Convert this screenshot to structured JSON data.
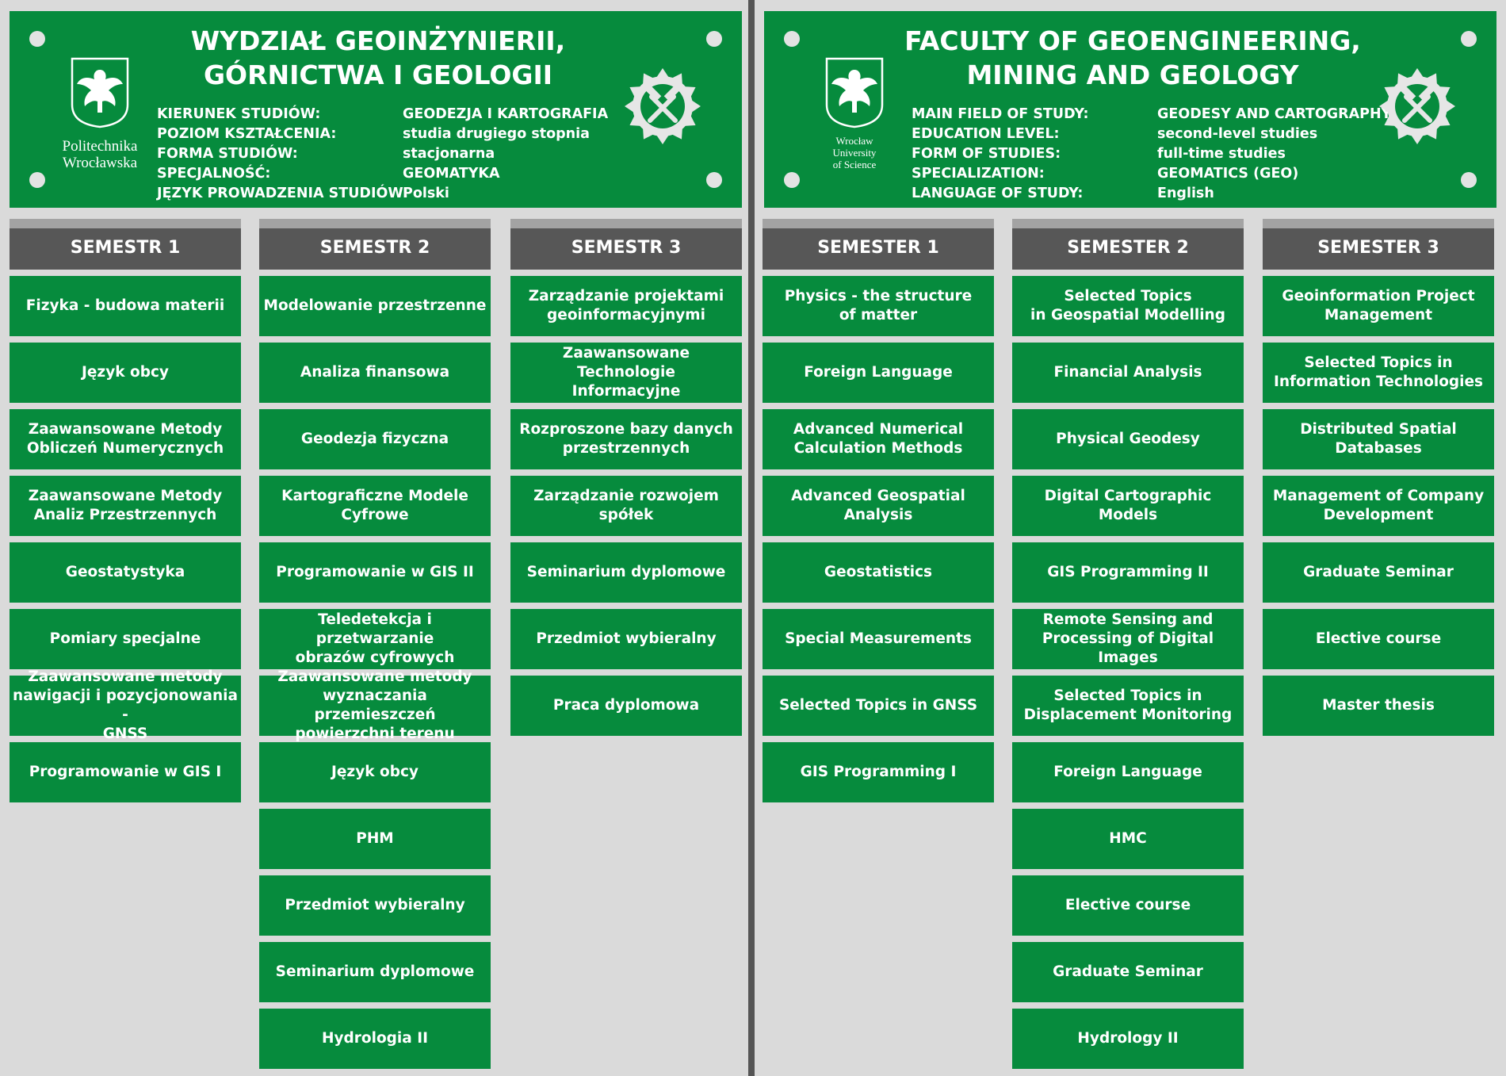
{
  "colors": {
    "green": "#068b3d",
    "semester_header": "#575757",
    "background": "#dadada"
  },
  "icons": {
    "logo": "eagle-crest-icon",
    "emblem": "gear-hammer-icon"
  },
  "pl": {
    "title": "WYDZIAŁ GEOINŻYNIERII,\nGÓRNICTWA I GEOLOGII",
    "logo_text": "Politechnika\nWrocławska",
    "info": [
      {
        "label": "KIERUNEK STUDIÓW:",
        "value": "GEODEZJA I KARTOGRAFIA"
      },
      {
        "label": "POZIOM KSZTAŁCENIA:",
        "value": "studia drugiego stopnia"
      },
      {
        "label": "FORMA STUDIÓW:",
        "value": "stacjonarna"
      },
      {
        "label": "SPECJALNOŚĆ:",
        "value": "GEOMATYKA"
      },
      {
        "label": "JĘZYK PROWADZENIA STUDIÓW:",
        "value": "Polski"
      }
    ],
    "semesters": [
      {
        "name": "SEMESTR 1",
        "courses": [
          "Fizyka - budowa materii",
          "Język obcy",
          "Zaawansowane Metody\nObliczeń Numerycznych",
          "Zaawansowane Metody\nAnaliz Przestrzennych",
          "Geostatystyka",
          "Pomiary specjalne",
          "Zaawansowane metody\nnawigacji i pozycjonowania -\nGNSS",
          "Programowanie w GIS I"
        ]
      },
      {
        "name": "SEMESTR 2",
        "courses": [
          "Modelowanie przestrzenne",
          "Analiza finansowa",
          "Geodezja fizyczna",
          "Kartograficzne Modele\nCyfrowe",
          "Programowanie w GIS II",
          "Teledetekcja i przetwarzanie\nobrazów cyfrowych",
          "Zaawansowane metody\nwyznaczania przemieszczeń\npowierzchni terenu",
          "Język obcy",
          "PHM",
          "Przedmiot wybieralny",
          "Seminarium dyplomowe",
          "Hydrologia II"
        ]
      },
      {
        "name": "SEMESTR 3",
        "courses": [
          "Zarządzanie projektami\ngeoinformacyjnymi",
          "Zaawansowane Technologie\nInformacyjne",
          "Rozproszone bazy danych\nprzestrzennych",
          "Zarządzanie rozwojem\nspółek",
          "Seminarium dyplomowe",
          "Przedmiot wybieralny",
          "Praca dyplomowa"
        ]
      }
    ]
  },
  "en": {
    "title": "FACULTY OF GEOENGINEERING,\nMINING AND GEOLOGY",
    "logo_text": "Wrocław\nUniversity\nof Science",
    "info": [
      {
        "label": "MAIN FIELD OF STUDY:",
        "value": "GEODESY AND CARTOGRAPHY"
      },
      {
        "label": "EDUCATION LEVEL:",
        "value": "second-level studies"
      },
      {
        "label": "FORM OF STUDIES:",
        "value": "full-time studies"
      },
      {
        "label": "SPECIALIZATION:",
        "value": "GEOMATICS (GEO)"
      },
      {
        "label": "LANGUAGE OF STUDY:",
        "value": "English"
      }
    ],
    "semesters": [
      {
        "name": "SEMESTER 1",
        "courses": [
          "Physics - the structure\nof matter",
          "Foreign Language",
          "Advanced Numerical\nCalculation Methods",
          "Advanced Geospatial\nAnalysis",
          "Geostatistics",
          "Special Measurements",
          "Selected Topics in GNSS",
          "GIS Programming I"
        ]
      },
      {
        "name": "SEMESTER 2",
        "courses": [
          "Selected Topics\nin Geospatial Modelling",
          "Financial Analysis",
          "Physical Geodesy",
          "Digital Cartographic\nModels",
          "GIS Programming II",
          "Remote Sensing and\nProcessing of Digital Images",
          "Selected Topics in\nDisplacement Monitoring",
          "Foreign Language",
          "HMC",
          "Elective course",
          "Graduate Seminar",
          "Hydrology II"
        ]
      },
      {
        "name": "SEMESTER 3",
        "courses": [
          "Geoinformation Project\nManagement",
          "Selected Topics in\nInformation Technologies",
          "Distributed Spatial\nDatabases",
          "Management of Company\nDevelopment",
          "Graduate Seminar",
          "Elective course",
          "Master thesis"
        ]
      }
    ]
  }
}
